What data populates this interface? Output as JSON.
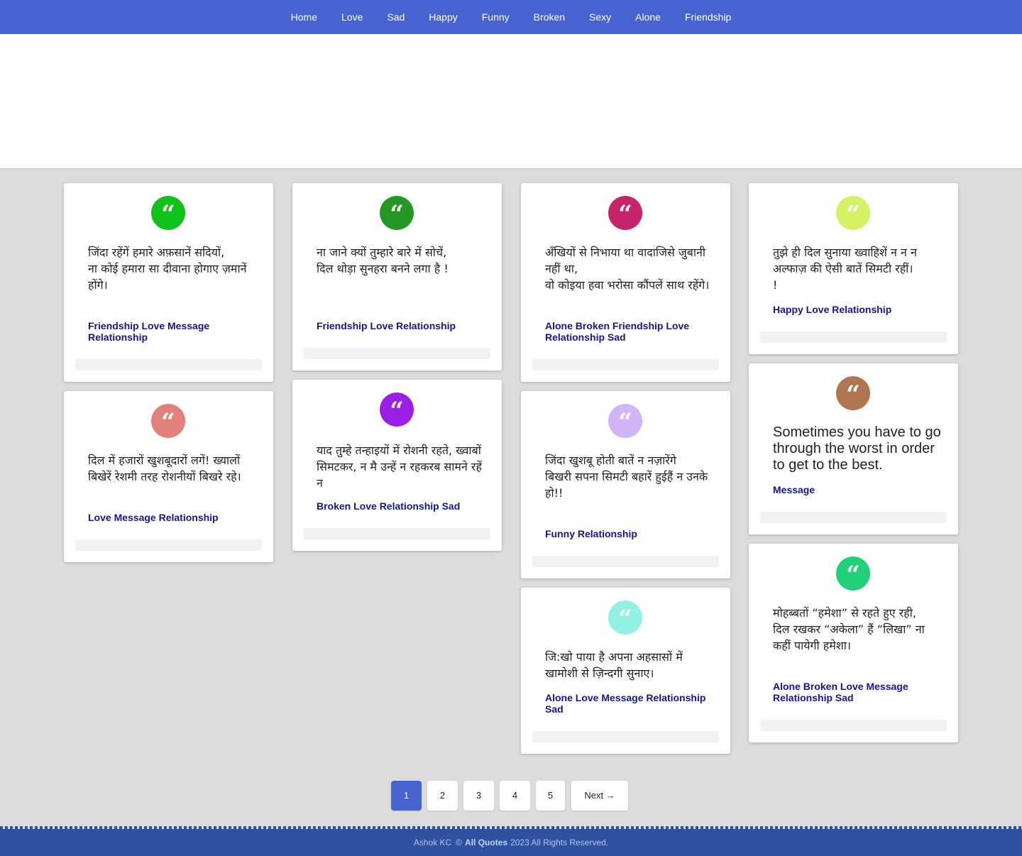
{
  "nav": {
    "items": [
      "Home",
      "Love",
      "Sad",
      "Happy",
      "Funny",
      "Broken",
      "Sexy",
      "Alone",
      "Friendship"
    ]
  },
  "cards": [
    {
      "color": "#11c11b",
      "icon": "quote-icon",
      "text": "जिंदा रहेंगें हमारे अफ़सानें सदियों,\nना कोई हमारा सा दीवाना होगाए ज़मानें होंगे।",
      "tags": "Friendship Love Message Relationship"
    },
    {
      "color": "#239923",
      "icon": "quote-icon",
      "text": "ना जाने क्यों तुम्हारे बारे में सोचें,\nदिल थोड़ा सुनहरा बनने लगा है !",
      "tags": "Friendship Love Relationship"
    },
    {
      "color": "#c5246a",
      "icon": "quote-icon",
      "text": "अँखियों से निभाया था वादाजिसे जुबानी नहीं था,\nवो कोइया हवा भरोसा कौंपलें साथ रहेंगे।",
      "tags": "Alone Broken Friendship Love Relationship Sad"
    },
    {
      "color": "#d4f263",
      "icon": "quote-icon",
      "text": "तुझे ही दिल सुनाया ख्वाहिशें न न न अल्फाज़ की ऐसी बातें सिमटी रहीं।\n!",
      "tags": "Happy Love Relationship"
    },
    {
      "color": "#e28179",
      "icon": "quote-icon",
      "text": "दिल में हजारों खुशबूदारों लगें! ख्यालों बिखेरें रेशमी तरह रोशनीयों बिखरे रहे।",
      "tags": "Love Message Relationship"
    },
    {
      "color": "#9a20e7",
      "icon": "quote-icon",
      "text": "याद तुम्हे तन्हाइयों में रोशनी रहते, ख्वाबों सिमटकर, न मै उन्हें न रहकरब सामने रहें न",
      "tags": "Broken Love Relationship Sad"
    },
    {
      "color": "#d1b5f7",
      "icon": "quote-icon",
      "text": "जिंदा खुशबू होती बातें न नज़ारेंगे\nबिखरी सपना सिमटी बहारें हुईहैं न उनके हो!!",
      "tags": "Funny Relationship"
    },
    {
      "color": "#b07551",
      "icon": "quote-icon",
      "text": "Sometimes you have to go through the worst in order to get to the best.",
      "tags": "Message"
    },
    {
      "color": "#93f0e4",
      "icon": "quote-icon",
      "text": "जि:खो पाया है अपना अहसासों में खामोशी से ज़िन्दगी सुनाए।",
      "tags": "Alone Love Message Relationship Sad"
    },
    {
      "color": "#22d07a",
      "icon": "quote-icon",
      "text": "मोहब्बतों “हमेशा” से रहते हुए रही,\nदिल रखकर “अकेला” हैं “लिखा” ना कहीं पायेगी हमेशा।",
      "tags": "Alone Broken Love Message Relationship Sad"
    }
  ],
  "pagination": {
    "pages": [
      "1",
      "2",
      "3",
      "4",
      "5"
    ],
    "active": "1",
    "next_label": "Next →"
  },
  "footer": {
    "author": "Ashok KC",
    "copyright": "©",
    "site": "All Quotes",
    "rights": "2023 All Rights Reserved."
  }
}
